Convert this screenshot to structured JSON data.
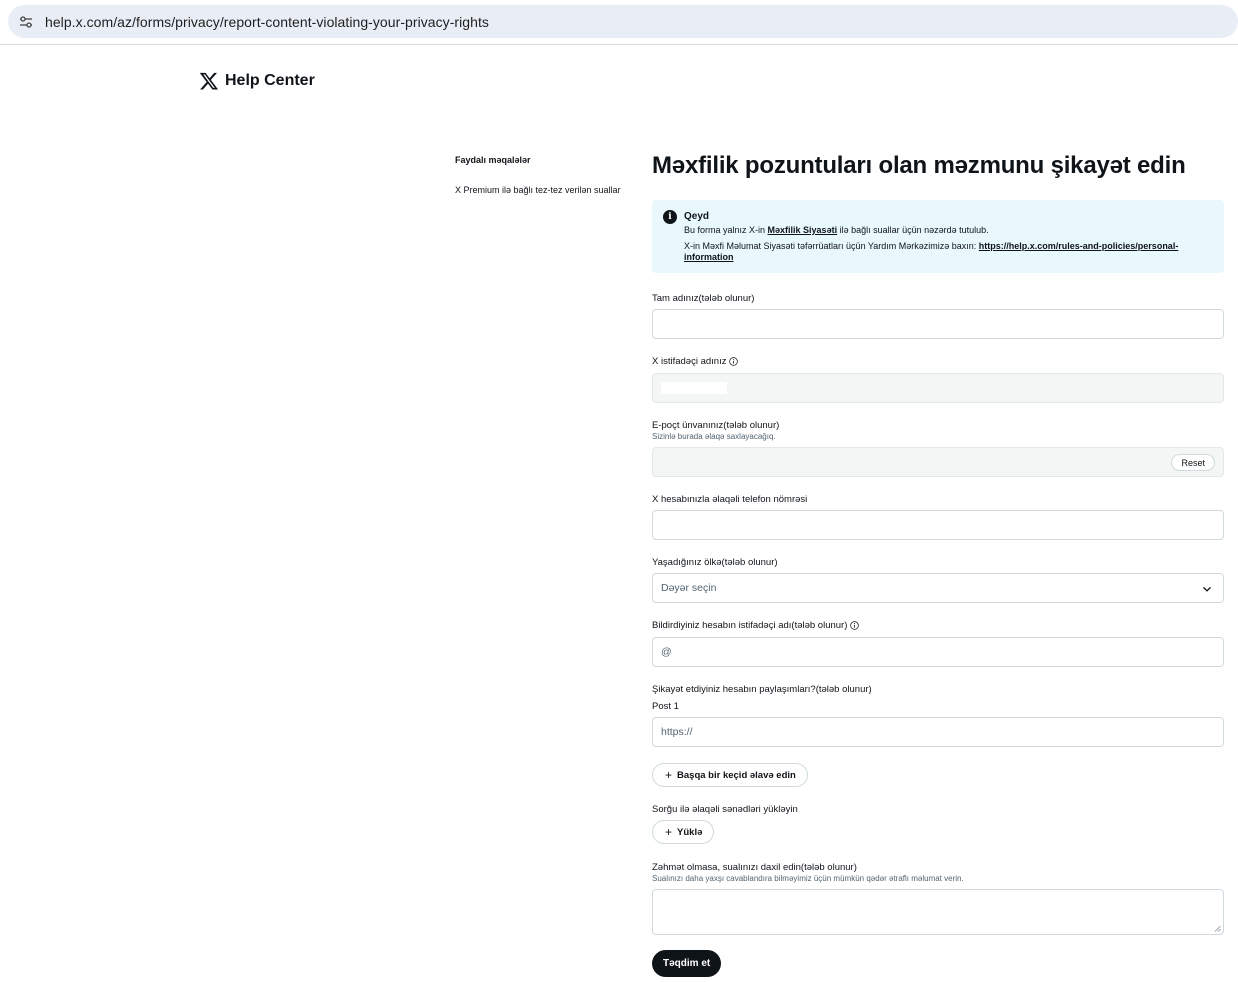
{
  "browser": {
    "url": "help.x.com/az/forms/privacy/report-content-violating-your-privacy-rights"
  },
  "header": {
    "logo_text": "Help Center"
  },
  "sidebar": {
    "title": "Faydalı məqalələr",
    "links": [
      "X Premium ilə bağlı tez-tez verilən suallar"
    ]
  },
  "form": {
    "title": "Məxfilik pozuntuları olan məzmunu şikayət edin",
    "note": {
      "title": "Qeyd",
      "line1_prefix": "Bu forma yalnız X-in ",
      "line1_link": "Məxfilik Siyasəti",
      "line1_suffix": " ilə bağlı suallar üçün nəzərdə tutulub.",
      "line2_prefix": "X-in Məxfi Məlumat Siyasəti təfərrüatları üçün Yardım Mərkəzimizə baxın: ",
      "line2_link": "https://help.x.com/rules-and-policies/personal-information"
    },
    "full_name": {
      "label": "Tam adınız",
      "required": " (tələb olunur)",
      "value": ""
    },
    "username": {
      "label": "X istifadəçi adınız"
    },
    "email": {
      "label": "E-poçt ünvanınız",
      "required": " (tələb olunur)",
      "sub": "Sizinlə burada əlaqə saxlayacağıq.",
      "reset_label": "Reset"
    },
    "phone": {
      "label": "X hesabınızla əlaqəli telefon nömrəsi",
      "value": ""
    },
    "country": {
      "label": "Yaşadığınız ölkə",
      "required": " (tələb olunur)",
      "placeholder": "Dəyər seçin"
    },
    "reported_username": {
      "label": "Bildirdiyiniz hesabın istifadəçi adı",
      "required": " (tələb olunur)",
      "placeholder": "@"
    },
    "posts": {
      "label": "Şikayət etdiyiniz hesabın paylaşımları?",
      "required": " (tələb olunur)",
      "post_label": "Post 1",
      "placeholder": "https://",
      "add_label": "Başqa bir keçid əlavə edin"
    },
    "upload": {
      "label": "Sorğu ilə əlaqəli sənədləri yükləyin",
      "button_label": "Yüklə"
    },
    "question": {
      "label": "Zəhmət olmasa, sualınızı daxil edin",
      "required": " (tələb olunur)",
      "sub": "Sualınızı daha yaxşı cavablandıra bilməyimiz üçün mümkün qədər ətraflı məlumat verin."
    },
    "submit_label": "Təqdim et"
  }
}
